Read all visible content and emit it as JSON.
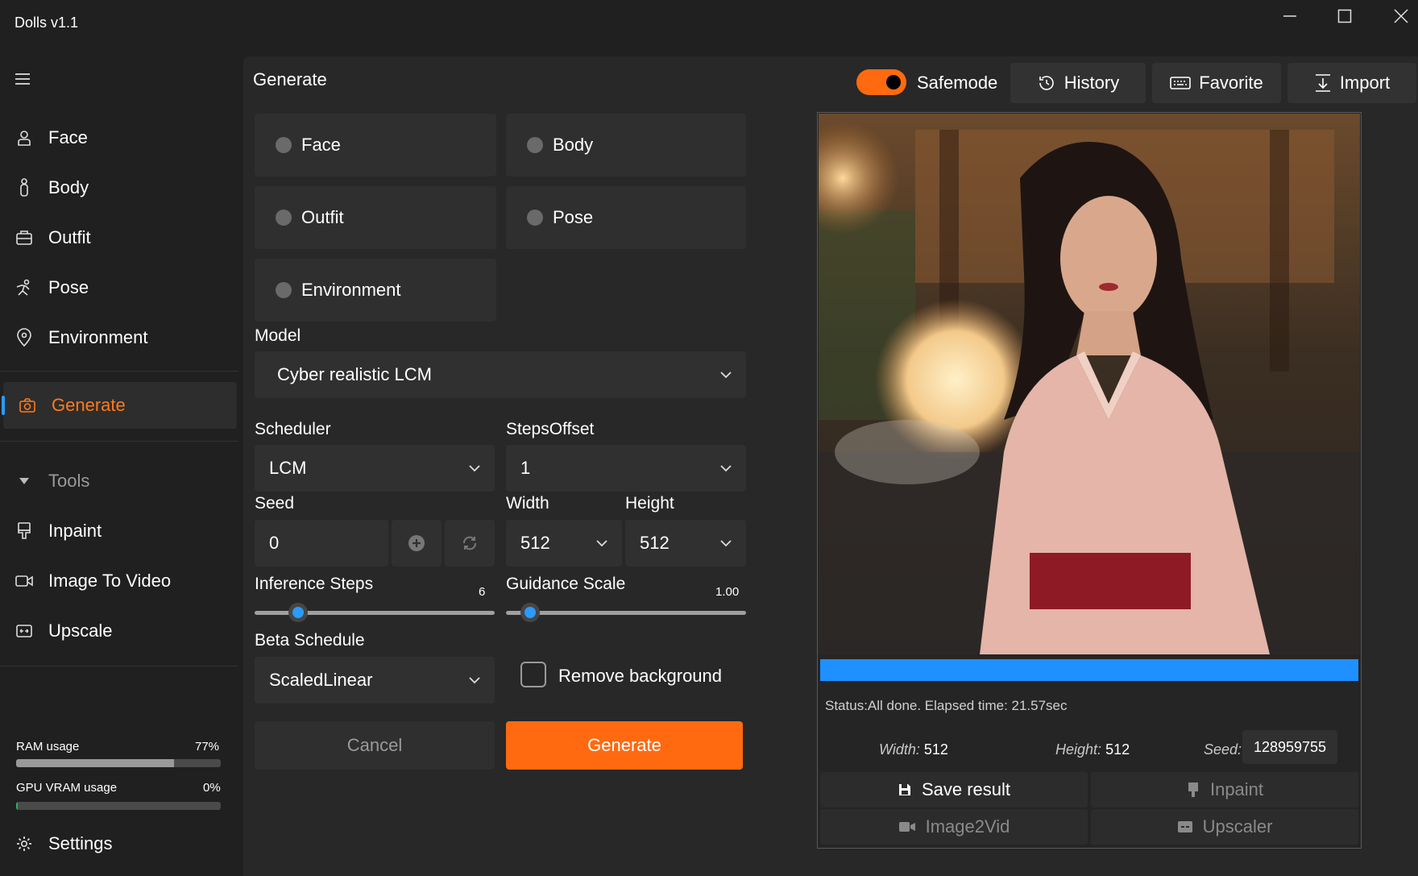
{
  "app": {
    "title": "Dolls v1.1"
  },
  "sidebar": {
    "items": [
      {
        "label": "Face",
        "icon": "face-icon"
      },
      {
        "label": "Body",
        "icon": "body-icon"
      },
      {
        "label": "Outfit",
        "icon": "outfit-icon"
      },
      {
        "label": "Pose",
        "icon": "pose-icon"
      },
      {
        "label": "Environment",
        "icon": "location-pin-icon"
      },
      {
        "label": "Generate",
        "icon": "camera-icon",
        "active": true
      },
      {
        "label": "Tools",
        "icon": "caret-down-icon"
      },
      {
        "label": "Inpaint",
        "icon": "brush-icon"
      },
      {
        "label": "Image To Video",
        "icon": "video-icon"
      },
      {
        "label": "Upscale",
        "icon": "upscale-icon"
      }
    ],
    "ram": {
      "label": "RAM usage",
      "value": "77%",
      "fraction": 0.77
    },
    "gpu": {
      "label": "GPU VRAM usage",
      "value": "0%",
      "fraction": 0.0
    },
    "settings": "Settings"
  },
  "header": {
    "title": "Generate",
    "safemode": "Safemode",
    "safemode_on": true,
    "history": "History",
    "favorite": "Favorite",
    "import": "Import"
  },
  "categories": [
    "Face",
    "Body",
    "Outfit",
    "Pose",
    "Environment"
  ],
  "form": {
    "model_label": "Model",
    "model_value": "Cyber realistic LCM",
    "scheduler_label": "Scheduler",
    "scheduler_value": "LCM",
    "steps_offset_label": "StepsOffset",
    "steps_offset_value": "1",
    "seed_label": "Seed",
    "seed_value": "0",
    "width_label": "Width",
    "width_value": "512",
    "height_label": "Height",
    "height_value": "512",
    "inference_label": "Inference Steps",
    "inference_value": "6",
    "inference_fraction": 0.18,
    "guidance_label": "Guidance Scale",
    "guidance_value": "1.00",
    "guidance_fraction": 0.1,
    "beta_label": "Beta Schedule",
    "beta_value": "ScaledLinear",
    "remove_bg_label": "Remove background",
    "remove_bg_checked": false,
    "cancel": "Cancel",
    "generate": "Generate"
  },
  "result": {
    "progress": 1.0,
    "status": "Status:All done. Elapsed time: 21.57sec",
    "width_label": "Width:",
    "width_value": "512",
    "height_label": "Height:",
    "height_value": "512",
    "seed_label": "Seed:",
    "seed_value": "128959755",
    "save": "Save result",
    "inpaint": "Inpaint",
    "image2vid": "Image2Vid",
    "upscaler": "Upscaler"
  },
  "colors": {
    "accent": "#ff6a10",
    "progress": "#1e90ff",
    "slider": "#2a9bff"
  }
}
